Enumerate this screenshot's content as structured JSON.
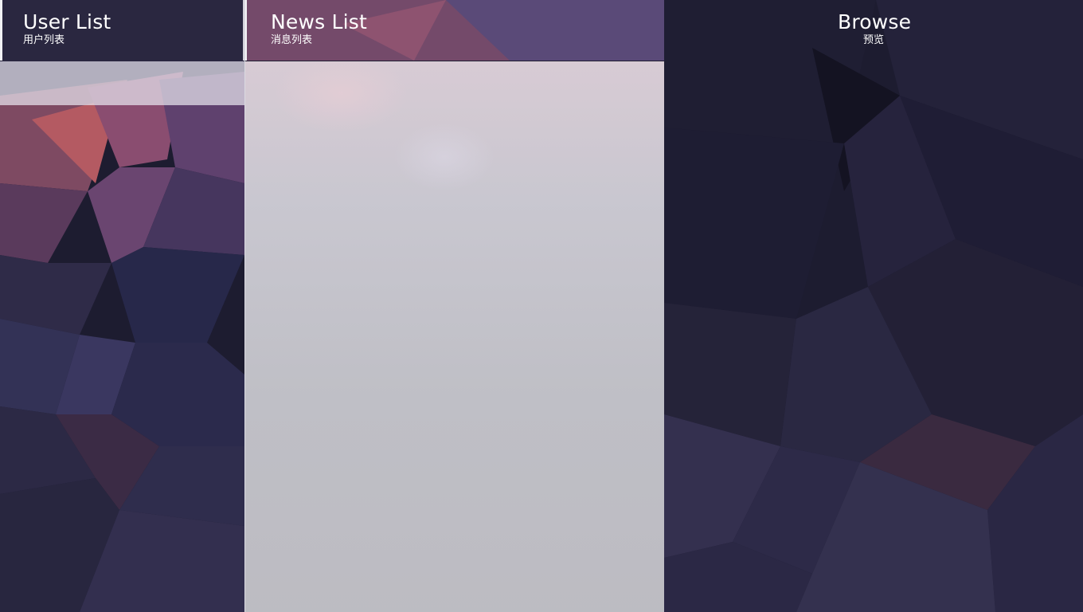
{
  "columns": {
    "users": {
      "title": "User List",
      "subtitle": "用户列表"
    },
    "news": {
      "title": "News List",
      "subtitle": "消息列表"
    },
    "browse": {
      "title": "Browse",
      "subtitle": "预览"
    }
  },
  "colors": {
    "background_dark": "#1c1b2e",
    "accent_warm": "#c06070",
    "header_text": "#ffffff",
    "panel_frost": "#c8c7cd"
  }
}
